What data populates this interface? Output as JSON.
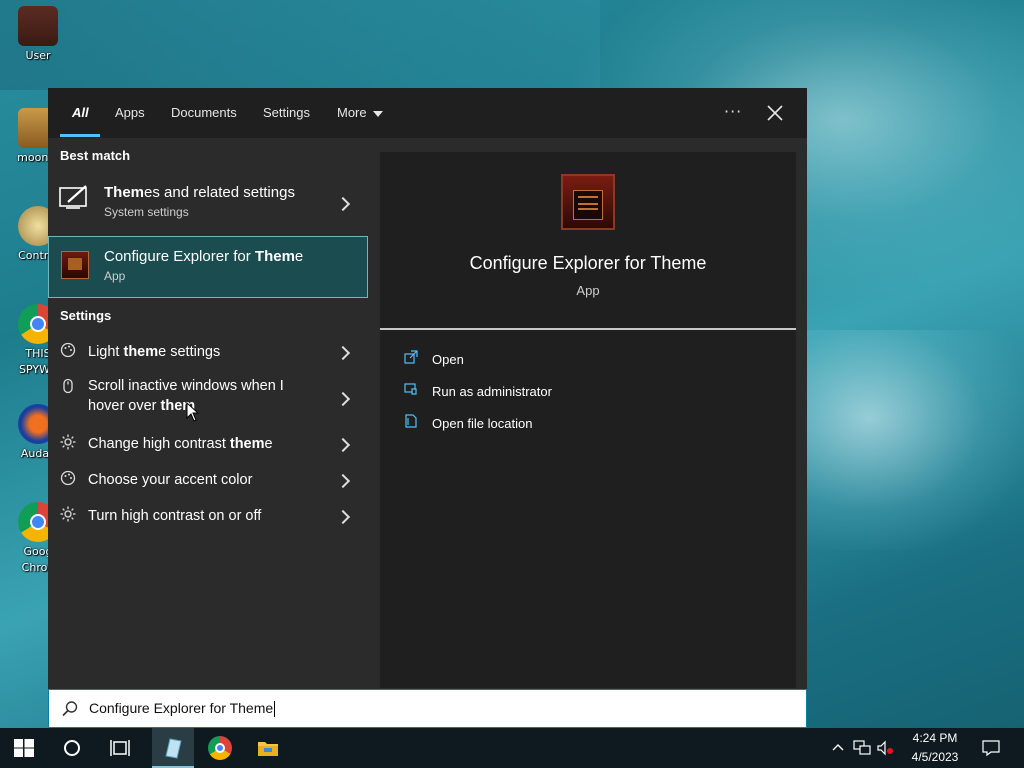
{
  "desktop": {
    "icons": [
      {
        "label": "User",
        "icon": "user-folder-icon"
      },
      {
        "label": "moon g",
        "icon": "game-icon"
      },
      {
        "label": "Control",
        "icon": "control-panel-icon"
      },
      {
        "label": "THIS\nSPYWA",
        "icon": "chrome-icon"
      },
      {
        "label": "Audac",
        "icon": "audacity-icon"
      },
      {
        "label": "Goog\nChron",
        "icon": "chrome-icon"
      }
    ]
  },
  "search": {
    "tabs": [
      {
        "label": "All",
        "active": true
      },
      {
        "label": "Apps"
      },
      {
        "label": "Documents"
      },
      {
        "label": "Settings"
      },
      {
        "label": "More"
      }
    ],
    "more_menu_icon": "ellipsis-icon",
    "close_icon": "close-icon",
    "best_match_title": "Best match",
    "best_match": [
      {
        "title_bold": "Them",
        "title_rest": "es and related settings",
        "subtitle": "System settings",
        "icon": "theme-brush-icon"
      },
      {
        "title_pre": "Configure Explorer for ",
        "title_bold": "Them",
        "title_rest": "e",
        "subtitle": "App",
        "icon": "app-icon",
        "selected": true
      }
    ],
    "settings_title": "Settings",
    "settings_items": [
      {
        "pre": "Light ",
        "bold": "them",
        "post": "e settings",
        "icon": "palette-icon"
      },
      {
        "pre": "Scroll inactive windows when I\nhover over ",
        "bold": "them",
        "post": "",
        "icon": "mouse-icon"
      },
      {
        "pre": "Change high contrast ",
        "bold": "them",
        "post": "e",
        "icon": "brightness-icon"
      },
      {
        "pre": "Choose your accent color",
        "bold": "",
        "post": "",
        "icon": "palette-icon"
      },
      {
        "pre": "Turn high contrast on or off",
        "bold": "",
        "post": "",
        "icon": "brightness-icon"
      }
    ],
    "preview": {
      "title": "Configure Explorer for Theme",
      "type": "App",
      "actions": [
        {
          "label": "Open",
          "icon": "open-icon"
        },
        {
          "label": "Run as administrator",
          "icon": "shield-icon"
        },
        {
          "label": "Open file location",
          "icon": "file-location-icon"
        }
      ]
    },
    "query": "Configure Explorer for Theme"
  },
  "taskbar": {
    "time": "4:24 PM",
    "date": "4/5/2023"
  },
  "colors": {
    "accent": "#4cc2ff",
    "selected_bg": "#1a4c50",
    "panel_bg": "#2b2b2b",
    "taskbar_bg": "#0e1a1f"
  }
}
